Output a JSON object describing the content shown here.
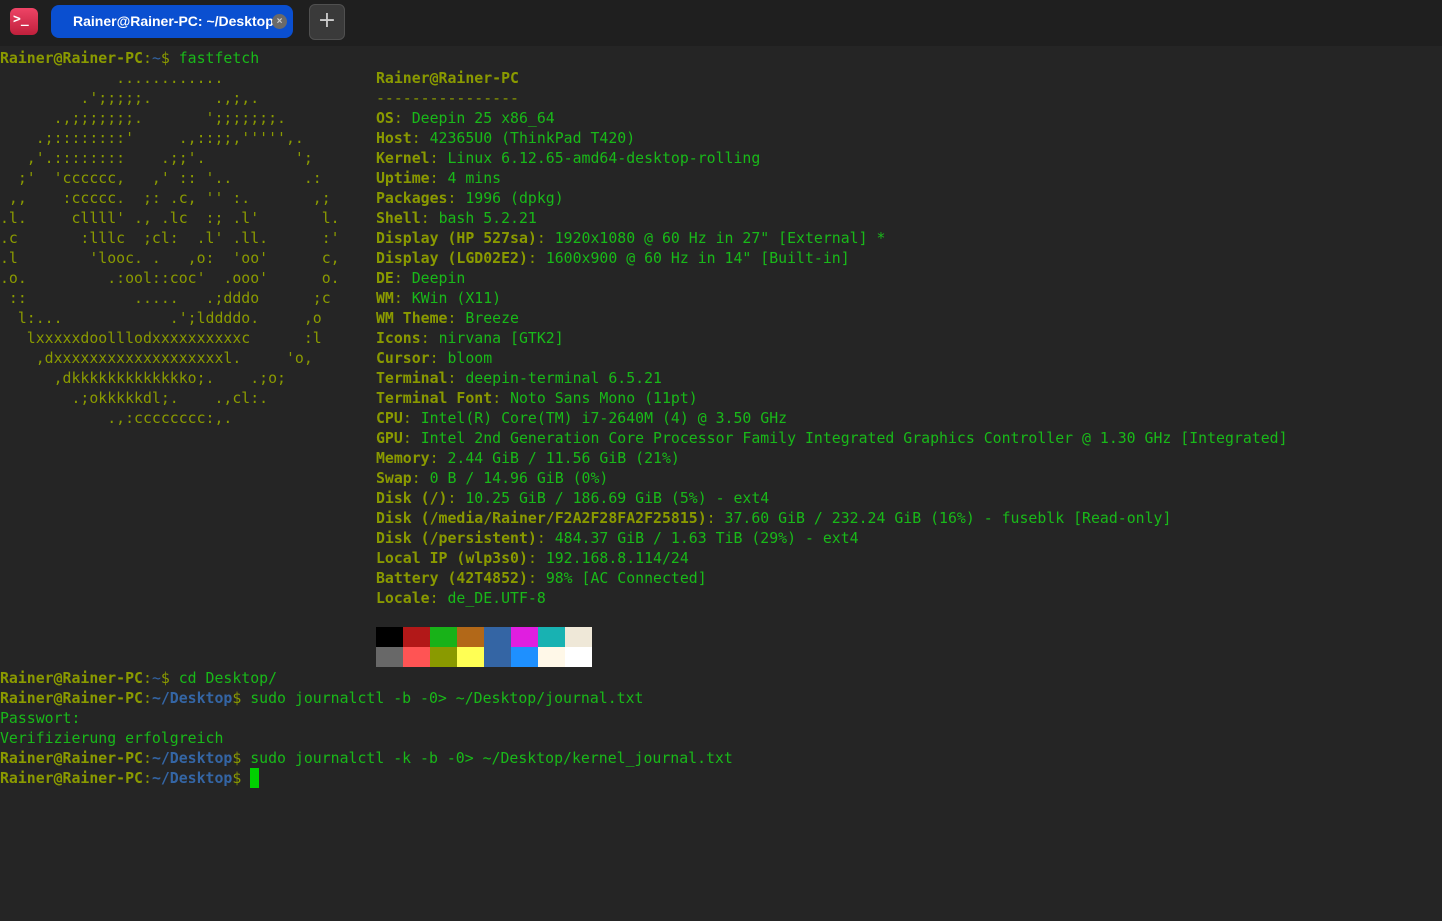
{
  "window": {
    "tab_title": "Rainer@Rainer-PC: ~/Desktop",
    "new_tab_label": "+",
    "close_label": "×",
    "app_icon_label": ">_"
  },
  "colors": {
    "prompt_user": "#8a9a00",
    "prompt_path": "#3465a4",
    "text": "#19b919",
    "cursor": "#00d000"
  },
  "prompt": {
    "user": "Rainer@Rainer-PC",
    "colon": ":",
    "home": "~",
    "desktop": "~/Desktop",
    "dollar": "$ "
  },
  "first_command": "fastfetch",
  "ascii_art": [
    "             ............",
    "         .';;;;;.       .,;,.",
    "      .,;;;;;;;.       ';;;;;;;.",
    "    .;::::::::'     .,::;;,''''',.",
    "   ,'.::::::::    .;;'.          ';",
    "  ;'  'cccccc,   ,' :: '..        .:",
    " ,,    :ccccc.  ;: .c, '' :.       ,;",
    ".l.     cllll' ., .lc  :; .l'       l.",
    ".c       :lllc  ;cl:  .l' .ll.      :'",
    ".l        'looc. .   ,o:  'oo'      c,",
    ".o.         .:ool::coc'  .ooo'      o.",
    " ::            .....   .;dddo      ;c",
    "  l:...            .';lddddo.     ,o",
    "   lxxxxxdoolllodxxxxxxxxxxc      :l",
    "    ,dxxxxxxxxxxxxxxxxxxxl.     'o,",
    "      ,dkkkkkkkkkkkkko;.    .;o;",
    "        .;okkkkkdl;.    .,cl:.",
    "            .,:cccccccc:,."
  ],
  "info": {
    "title": "Rainer@Rainer-PC",
    "separator": "----------------",
    "rows": [
      {
        "key": "OS",
        "value": "Deepin 25 x86_64"
      },
      {
        "key": "Host",
        "value": "42365U0 (ThinkPad T420)"
      },
      {
        "key": "Kernel",
        "value": "Linux 6.12.65-amd64-desktop-rolling"
      },
      {
        "key": "Uptime",
        "value": "4 mins"
      },
      {
        "key": "Packages",
        "value": "1996 (dpkg)"
      },
      {
        "key": "Shell",
        "value": "bash 5.2.21"
      },
      {
        "key": "Display (HP 527sa)",
        "value": "1920x1080 @ 60 Hz in 27\" [External] *"
      },
      {
        "key": "Display (LGD02E2)",
        "value": "1600x900 @ 60 Hz in 14\" [Built-in]"
      },
      {
        "key": "DE",
        "value": "Deepin"
      },
      {
        "key": "WM",
        "value": "KWin (X11)"
      },
      {
        "key": "WM Theme",
        "value": "Breeze"
      },
      {
        "key": "Icons",
        "value": "nirvana [GTK2]"
      },
      {
        "key": "Cursor",
        "value": "bloom"
      },
      {
        "key": "Terminal",
        "value": "deepin-terminal 6.5.21"
      },
      {
        "key": "Terminal Font",
        "value": "Noto Sans Mono (11pt)"
      },
      {
        "key": "CPU",
        "value": "Intel(R) Core(TM) i7-2640M (4) @ 3.50 GHz"
      },
      {
        "key": "GPU",
        "value": "Intel 2nd Generation Core Processor Family Integrated Graphics Controller @ 1.30 GHz [Integrated]"
      },
      {
        "key": "Memory",
        "value": "2.44 GiB / 11.56 GiB (21%)"
      },
      {
        "key": "Swap",
        "value": "0 B / 14.96 GiB (0%)"
      },
      {
        "key": "Disk (/)",
        "value": "10.25 GiB / 186.69 GiB (5%) - ext4"
      },
      {
        "key": "Disk (/media/Rainer/F2A2F28FA2F25815)",
        "value": "37.60 GiB / 232.24 GiB (16%) - fuseblk [Read-only]"
      },
      {
        "key": "Disk (/persistent)",
        "value": "484.37 GiB / 1.63 TiB (29%) - ext4"
      },
      {
        "key": "Local IP (wlp3s0)",
        "value": "192.168.8.114/24"
      },
      {
        "key": "Battery (42T4852)",
        "value": "98% [AC Connected]"
      },
      {
        "key": "Locale",
        "value": "de_DE.UTF-8"
      }
    ],
    "key_sep": ": "
  },
  "palette": [
    "#000000",
    "#b21818",
    "#18b218",
    "#b26818",
    "#3465a4",
    "#e01ee0",
    "#18b2b2",
    "#efe8d8",
    "#686868",
    "#ff5454",
    "#8a9a00",
    "#ffff54",
    "#3465a4",
    "#1e90ff",
    "#fff8e8",
    "#ffffff"
  ],
  "history": [
    {
      "path": "home",
      "command": "cd Desktop/"
    },
    {
      "path": "desktop",
      "command": "sudo journalctl -b -0> ~/Desktop/journal.txt"
    },
    {
      "output": "Passwort:"
    },
    {
      "output": "Verifizierung erfolgreich"
    },
    {
      "path": "desktop",
      "command": "sudo journalctl -k -b -0> ~/Desktop/kernel_journal.txt"
    },
    {
      "path": "desktop",
      "command": "",
      "cursor": true
    }
  ]
}
